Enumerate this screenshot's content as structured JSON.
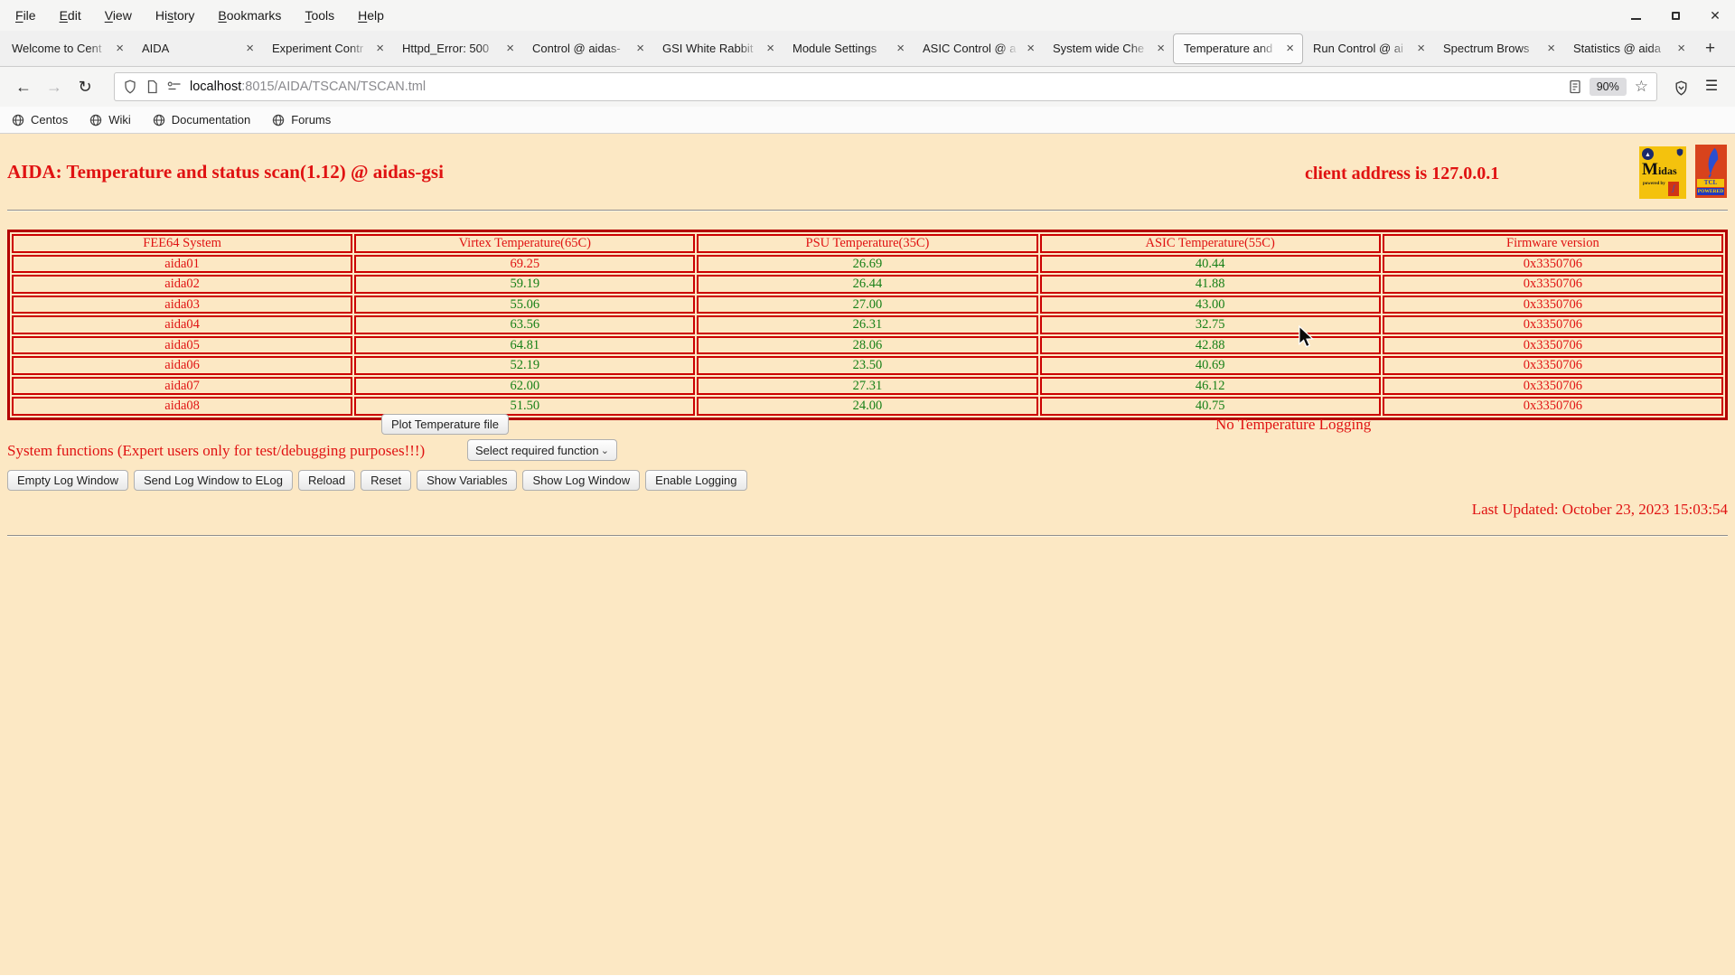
{
  "window": {
    "menu_items": [
      {
        "label": "File",
        "accel": 0
      },
      {
        "label": "Edit",
        "accel": 0
      },
      {
        "label": "View",
        "accel": 0
      },
      {
        "label": "History",
        "accel": 2
      },
      {
        "label": "Bookmarks",
        "accel": 0
      },
      {
        "label": "Tools",
        "accel": 0
      },
      {
        "label": "Help",
        "accel": 0
      }
    ]
  },
  "tabs": {
    "items": [
      {
        "label": "Welcome to Cent",
        "active": false
      },
      {
        "label": "AIDA",
        "active": false
      },
      {
        "label": "Experiment Contr",
        "active": false
      },
      {
        "label": "Httpd_Error: 500",
        "active": false
      },
      {
        "label": "Control @ aidas-",
        "active": false
      },
      {
        "label": "GSI White Rabbit",
        "active": false
      },
      {
        "label": "Module Settings",
        "active": false
      },
      {
        "label": "ASIC Control @ a",
        "active": false
      },
      {
        "label": "System wide Che",
        "active": false
      },
      {
        "label": "Temperature and",
        "active": true
      },
      {
        "label": "Run Control @ ai",
        "active": false
      },
      {
        "label": "Spectrum Brows",
        "active": false
      },
      {
        "label": "Statistics @ aida",
        "active": false
      }
    ],
    "close_glyph": "×",
    "new_tab_glyph": "+"
  },
  "navbar": {
    "back_glyph": "←",
    "forward_glyph": "→",
    "reload_glyph": "↻",
    "url_host": "localhost",
    "url_rest": ":8015/AIDA/TSCAN/TSCAN.tml",
    "zoom_badge": "90%",
    "star_glyph": "☆",
    "menu_glyph": "☰"
  },
  "bookmarks": [
    {
      "label": "Centos"
    },
    {
      "label": "Wiki"
    },
    {
      "label": "Documentation"
    },
    {
      "label": "Forums"
    }
  ],
  "page": {
    "title": "AIDA: Temperature and status scan(1.12) @ aidas-gsi",
    "client_address": "client address is 127.0.0.1",
    "logos": {
      "midas_name": "Midas",
      "midas_sub": "powered by",
      "tcl_name": "TCL",
      "tcl_sub": "POWERED"
    },
    "table": {
      "headers": [
        "FEE64 System",
        "Virtex Temperature(65C)",
        "PSU Temperature(35C)",
        "ASIC Temperature(55C)",
        "Firmware version"
      ],
      "column_colors": [
        "red",
        "green",
        "green",
        "green",
        "red"
      ],
      "rows": [
        [
          "aida01",
          "69.25",
          "26.69",
          "40.44",
          "0x3350706"
        ],
        [
          "aida02",
          "59.19",
          "26.44",
          "41.88",
          "0x3350706"
        ],
        [
          "aida03",
          "55.06",
          "27.00",
          "43.00",
          "0x3350706"
        ],
        [
          "aida04",
          "63.56",
          "26.31",
          "32.75",
          "0x3350706"
        ],
        [
          "aida05",
          "64.81",
          "28.06",
          "42.88",
          "0x3350706"
        ],
        [
          "aida06",
          "52.19",
          "23.50",
          "40.69",
          "0x3350706"
        ],
        [
          "aida07",
          "62.00",
          "27.31",
          "46.12",
          "0x3350706"
        ],
        [
          "aida08",
          "51.50",
          "24.00",
          "40.75",
          "0x3350706"
        ]
      ],
      "alert_cells": [
        [
          0,
          1
        ]
      ]
    },
    "plot_button": "Plot Temperature file",
    "no_logging": "No Temperature Logging",
    "system_functions": "System functions (Expert users only for test/debugging purposes!!!)",
    "function_select": "Select required function",
    "select_chevron": "⌄",
    "log_buttons": [
      "Empty Log Window",
      "Send Log Window to ELog",
      "Reload",
      "Reset",
      "Show Variables",
      "Show Log Window",
      "Enable Logging"
    ],
    "last_updated": "Last Updated: October 23, 2023 15:03:54",
    "colors": {
      "red": "#e01212",
      "green": "#178017",
      "tableBorder": "#cc0000",
      "tableOuter": "#b30000",
      "pageBg": "#fce8c4"
    }
  }
}
